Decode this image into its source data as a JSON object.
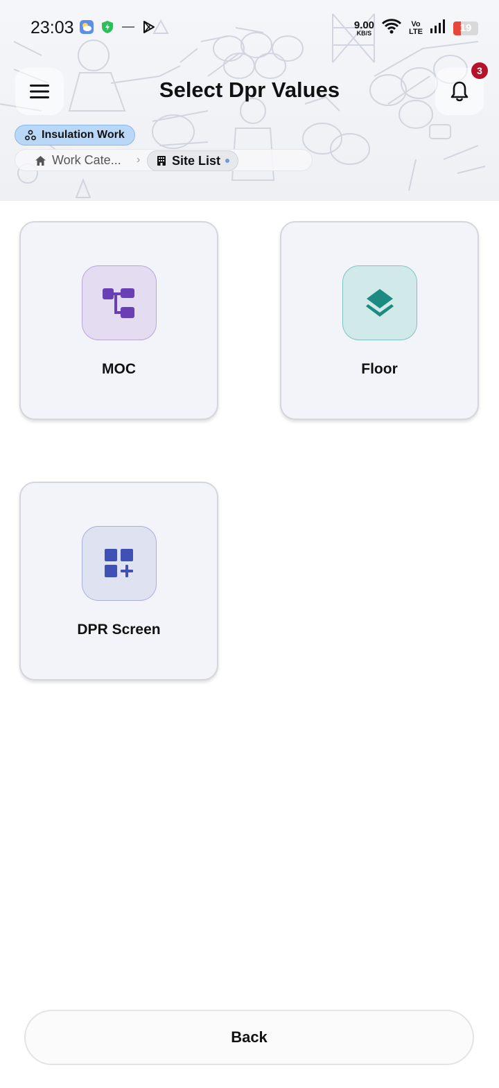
{
  "status_bar": {
    "time": "23:03",
    "net_speed_value": "9.00",
    "net_speed_unit": "KB/S",
    "volte_top": "Vo",
    "volte_bottom": "LTE",
    "battery_level": "19",
    "icons": [
      "weather-icon",
      "shield-icon",
      "dash-icon",
      "play-store-icon",
      "wifi-icon",
      "signal-icon",
      "battery-icon"
    ]
  },
  "app_bar": {
    "title": "Select Dpr Values",
    "notification_count": "3"
  },
  "category_chip": {
    "label": "Insulation Work",
    "icon": "group-icon"
  },
  "breadcrumb": {
    "home_label": "Work Cate...",
    "separator": "›",
    "active_label": "Site List"
  },
  "cards": [
    {
      "label": "MOC",
      "icon": "hierarchy-icon",
      "color": "#6a3fb5"
    },
    {
      "label": "Floor",
      "icon": "layers-icon",
      "color": "#1b8a80"
    },
    {
      "label": "DPR Screen",
      "icon": "dashboard-add-icon",
      "color": "#3f51b5"
    }
  ],
  "footer": {
    "back_label": "Back"
  }
}
